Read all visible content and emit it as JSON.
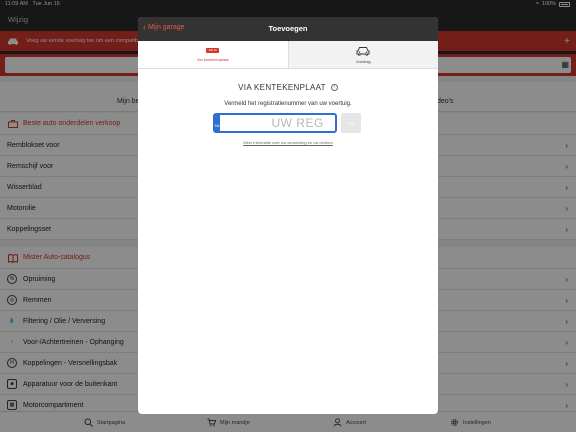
{
  "status_bar": {
    "time": "11:09 AM",
    "date": "Tue Jun 16",
    "battery": "100%"
  },
  "app": {
    "edit_label": "Wijzig",
    "banner_text": "Voeg uw eerste voertuig toe om een compatible onderdeel...",
    "tabs": [
      "Mijn be",
      "deo's"
    ],
    "sections": [
      {
        "title": "Beste auto onderdelen verkoop",
        "icon": "toolbox-icon",
        "items": [
          "Remblokset voor",
          "Remschijf voor",
          "Wisserblad",
          "Motorolie",
          "Koppelingsset"
        ]
      },
      {
        "title": "Mister Auto-catalogus",
        "icon": "book-icon",
        "items": [
          "Opruiming",
          "Remmen",
          "Filtering / Olie / Verversing",
          "Voor-/Achtertreinen - Ophanging",
          "Koppelingen - Versnellingsbak",
          "Apparatuur voor de buitenkant",
          "Motorcompartiment"
        ]
      }
    ],
    "tabbar": [
      {
        "label": "Startpagina",
        "icon": "search-icon"
      },
      {
        "label": "Mijn mandje",
        "icon": "cart-icon"
      },
      {
        "label": "Account",
        "icon": "user-icon"
      },
      {
        "label": "Instellingen",
        "icon": "gear-icon"
      }
    ]
  },
  "modal": {
    "back_label": "Mijn garage",
    "title": "Toevoegen",
    "tabs": [
      {
        "label": "Via kentekenplaat",
        "active": true
      },
      {
        "label": "Voertuig",
        "active": false
      }
    ],
    "heading": "VIA KENTEKENPLAAT",
    "description": "Vermeld het registratienummer van uw voertuig.",
    "plate": {
      "country": "NL",
      "placeholder": "UW REG",
      "value": ""
    },
    "go_label": "GO",
    "more_info": "Meer informatie over uw verwerking en uw rechten"
  },
  "colors": {
    "accent": "#d2382c",
    "plate_blue": "#2f6fd1",
    "header_dark": "#333333"
  }
}
